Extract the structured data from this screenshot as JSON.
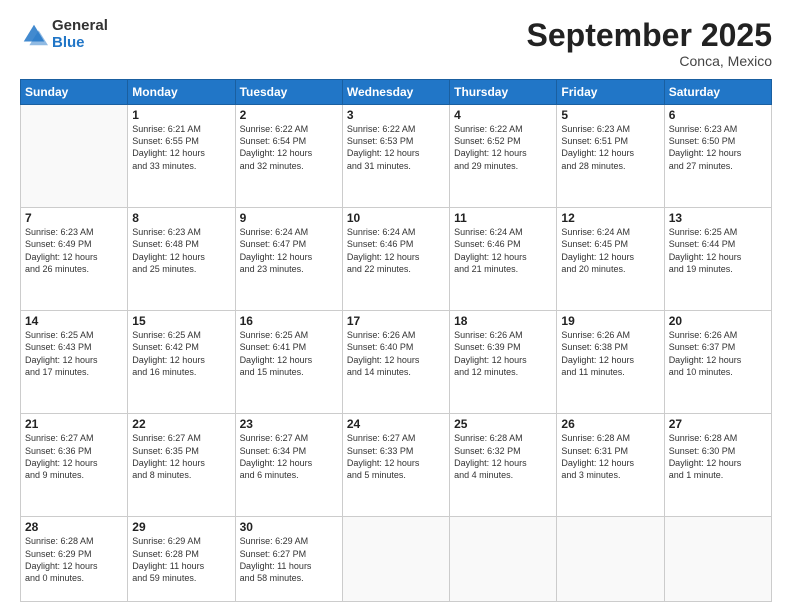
{
  "header": {
    "logo_general": "General",
    "logo_blue": "Blue",
    "month_title": "September 2025",
    "location": "Conca, Mexico"
  },
  "days_of_week": [
    "Sunday",
    "Monday",
    "Tuesday",
    "Wednesday",
    "Thursday",
    "Friday",
    "Saturday"
  ],
  "weeks": [
    [
      {
        "num": "",
        "info": ""
      },
      {
        "num": "1",
        "info": "Sunrise: 6:21 AM\nSunset: 6:55 PM\nDaylight: 12 hours\nand 33 minutes."
      },
      {
        "num": "2",
        "info": "Sunrise: 6:22 AM\nSunset: 6:54 PM\nDaylight: 12 hours\nand 32 minutes."
      },
      {
        "num": "3",
        "info": "Sunrise: 6:22 AM\nSunset: 6:53 PM\nDaylight: 12 hours\nand 31 minutes."
      },
      {
        "num": "4",
        "info": "Sunrise: 6:22 AM\nSunset: 6:52 PM\nDaylight: 12 hours\nand 29 minutes."
      },
      {
        "num": "5",
        "info": "Sunrise: 6:23 AM\nSunset: 6:51 PM\nDaylight: 12 hours\nand 28 minutes."
      },
      {
        "num": "6",
        "info": "Sunrise: 6:23 AM\nSunset: 6:50 PM\nDaylight: 12 hours\nand 27 minutes."
      }
    ],
    [
      {
        "num": "7",
        "info": "Sunrise: 6:23 AM\nSunset: 6:49 PM\nDaylight: 12 hours\nand 26 minutes."
      },
      {
        "num": "8",
        "info": "Sunrise: 6:23 AM\nSunset: 6:48 PM\nDaylight: 12 hours\nand 25 minutes."
      },
      {
        "num": "9",
        "info": "Sunrise: 6:24 AM\nSunset: 6:47 PM\nDaylight: 12 hours\nand 23 minutes."
      },
      {
        "num": "10",
        "info": "Sunrise: 6:24 AM\nSunset: 6:46 PM\nDaylight: 12 hours\nand 22 minutes."
      },
      {
        "num": "11",
        "info": "Sunrise: 6:24 AM\nSunset: 6:46 PM\nDaylight: 12 hours\nand 21 minutes."
      },
      {
        "num": "12",
        "info": "Sunrise: 6:24 AM\nSunset: 6:45 PM\nDaylight: 12 hours\nand 20 minutes."
      },
      {
        "num": "13",
        "info": "Sunrise: 6:25 AM\nSunset: 6:44 PM\nDaylight: 12 hours\nand 19 minutes."
      }
    ],
    [
      {
        "num": "14",
        "info": "Sunrise: 6:25 AM\nSunset: 6:43 PM\nDaylight: 12 hours\nand 17 minutes."
      },
      {
        "num": "15",
        "info": "Sunrise: 6:25 AM\nSunset: 6:42 PM\nDaylight: 12 hours\nand 16 minutes."
      },
      {
        "num": "16",
        "info": "Sunrise: 6:25 AM\nSunset: 6:41 PM\nDaylight: 12 hours\nand 15 minutes."
      },
      {
        "num": "17",
        "info": "Sunrise: 6:26 AM\nSunset: 6:40 PM\nDaylight: 12 hours\nand 14 minutes."
      },
      {
        "num": "18",
        "info": "Sunrise: 6:26 AM\nSunset: 6:39 PM\nDaylight: 12 hours\nand 12 minutes."
      },
      {
        "num": "19",
        "info": "Sunrise: 6:26 AM\nSunset: 6:38 PM\nDaylight: 12 hours\nand 11 minutes."
      },
      {
        "num": "20",
        "info": "Sunrise: 6:26 AM\nSunset: 6:37 PM\nDaylight: 12 hours\nand 10 minutes."
      }
    ],
    [
      {
        "num": "21",
        "info": "Sunrise: 6:27 AM\nSunset: 6:36 PM\nDaylight: 12 hours\nand 9 minutes."
      },
      {
        "num": "22",
        "info": "Sunrise: 6:27 AM\nSunset: 6:35 PM\nDaylight: 12 hours\nand 8 minutes."
      },
      {
        "num": "23",
        "info": "Sunrise: 6:27 AM\nSunset: 6:34 PM\nDaylight: 12 hours\nand 6 minutes."
      },
      {
        "num": "24",
        "info": "Sunrise: 6:27 AM\nSunset: 6:33 PM\nDaylight: 12 hours\nand 5 minutes."
      },
      {
        "num": "25",
        "info": "Sunrise: 6:28 AM\nSunset: 6:32 PM\nDaylight: 12 hours\nand 4 minutes."
      },
      {
        "num": "26",
        "info": "Sunrise: 6:28 AM\nSunset: 6:31 PM\nDaylight: 12 hours\nand 3 minutes."
      },
      {
        "num": "27",
        "info": "Sunrise: 6:28 AM\nSunset: 6:30 PM\nDaylight: 12 hours\nand 1 minute."
      }
    ],
    [
      {
        "num": "28",
        "info": "Sunrise: 6:28 AM\nSunset: 6:29 PM\nDaylight: 12 hours\nand 0 minutes."
      },
      {
        "num": "29",
        "info": "Sunrise: 6:29 AM\nSunset: 6:28 PM\nDaylight: 11 hours\nand 59 minutes."
      },
      {
        "num": "30",
        "info": "Sunrise: 6:29 AM\nSunset: 6:27 PM\nDaylight: 11 hours\nand 58 minutes."
      },
      {
        "num": "",
        "info": ""
      },
      {
        "num": "",
        "info": ""
      },
      {
        "num": "",
        "info": ""
      },
      {
        "num": "",
        "info": ""
      }
    ]
  ]
}
